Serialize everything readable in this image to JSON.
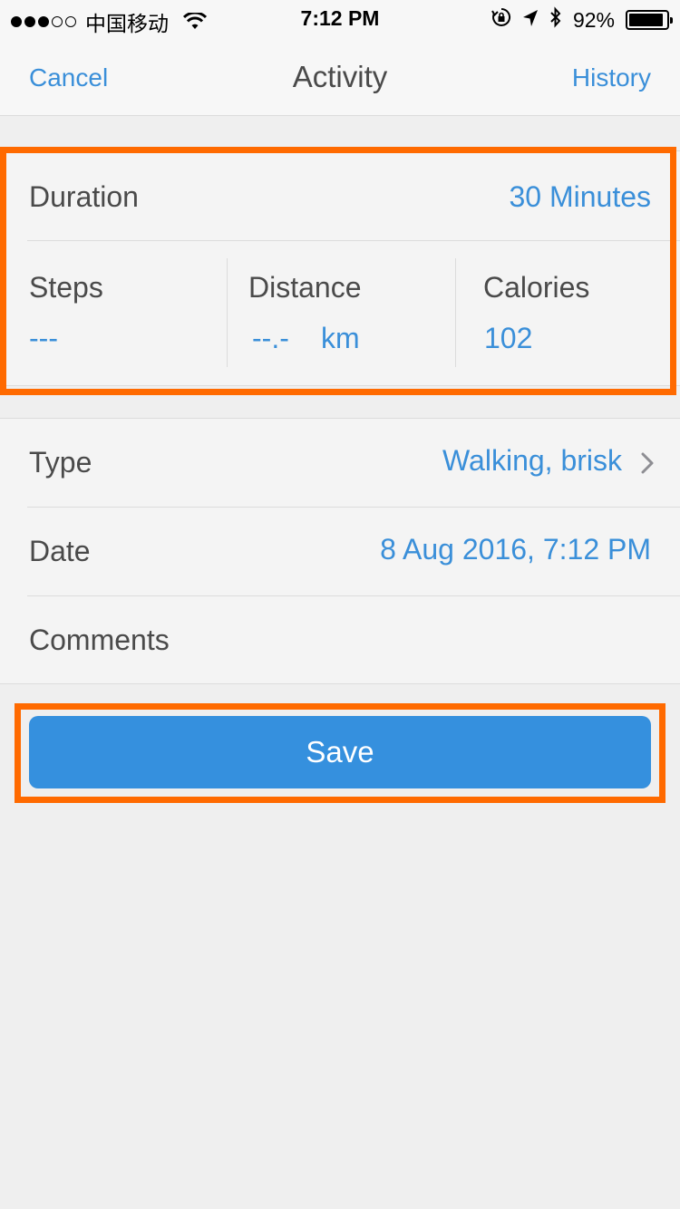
{
  "status_bar": {
    "carrier": "中国移动",
    "time": "7:12 PM",
    "battery_text": "92%",
    "battery_level": 0.92,
    "icons": [
      "signal-dots",
      "wifi-icon",
      "orientation-lock-icon",
      "location-arrow-icon",
      "bluetooth-icon",
      "battery-icon"
    ]
  },
  "nav": {
    "cancel_label": "Cancel",
    "title": "Activity",
    "history_label": "History"
  },
  "summary": {
    "duration_label": "Duration",
    "duration_value": "30 Minutes",
    "steps_label": "Steps",
    "steps_value": "---",
    "distance_label": "Distance",
    "distance_value": "--.-",
    "distance_unit": "km",
    "calories_label": "Calories",
    "calories_value": "102"
  },
  "details": {
    "type_label": "Type",
    "type_value": "Walking, brisk",
    "date_label": "Date",
    "date_value": "8 Aug 2016, 7:12 PM",
    "comments_label": "Comments"
  },
  "actions": {
    "save_label": "Save"
  },
  "colors": {
    "accent": "#3a8fd9",
    "button": "#3590de",
    "highlight": "#ff6a00",
    "background": "#efefef"
  }
}
